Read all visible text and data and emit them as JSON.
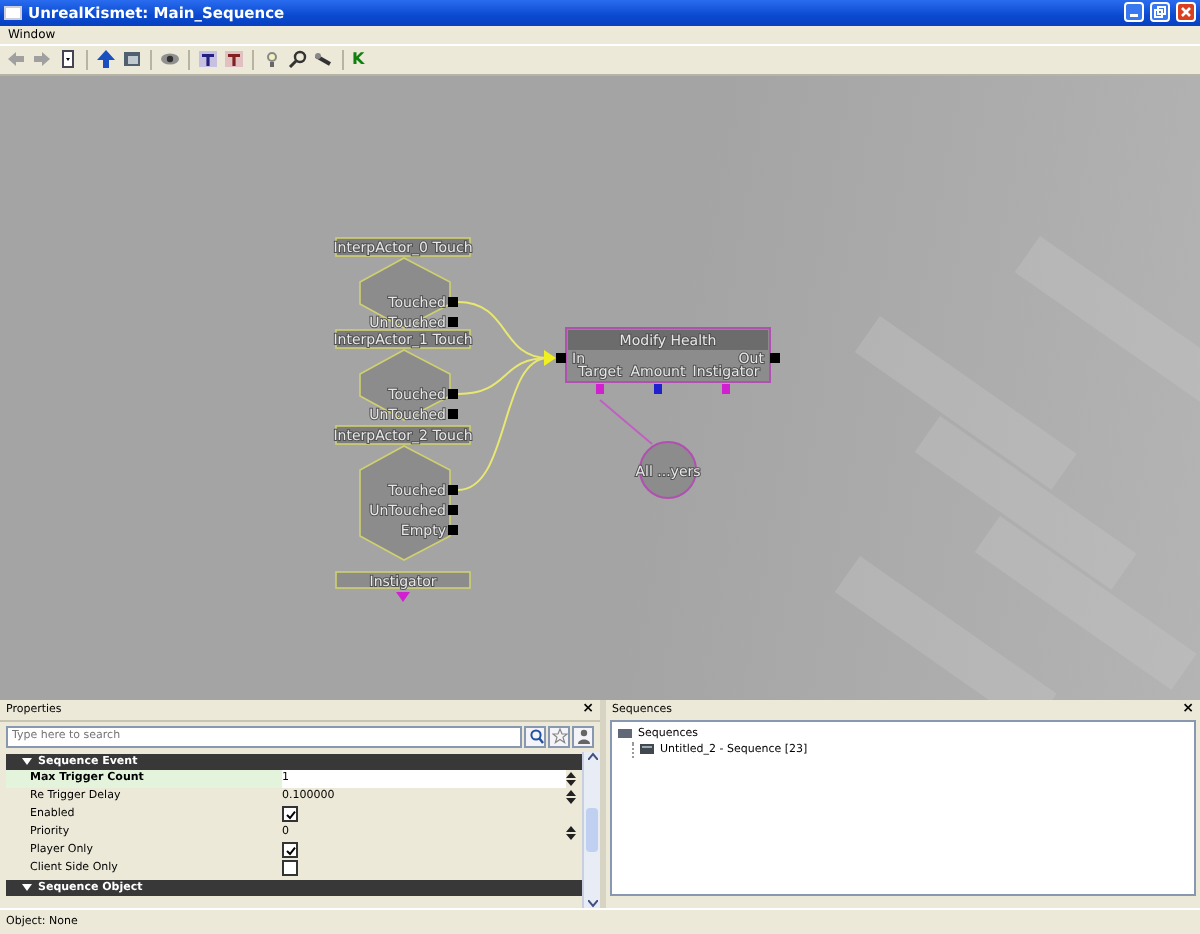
{
  "window": {
    "title": "UnrealKismet: Main_Sequence"
  },
  "menu": [
    "Window"
  ],
  "toolbar": {
    "k_button": "K"
  },
  "graph": {
    "events": [
      {
        "title": "InterpActor_0 Touch",
        "outputs": [
          "Touched",
          "UnTouched"
        ]
      },
      {
        "title": "InterpActor_1 Touch",
        "outputs": [
          "Touched",
          "UnTouched"
        ]
      },
      {
        "title": "InterpActor_2 Touch",
        "outputs": [
          "Touched",
          "UnTouched",
          "Empty"
        ]
      }
    ],
    "instigator": "Instigator",
    "action": {
      "title": "Modify Health",
      "input": "In",
      "output": "Out",
      "variables": [
        {
          "label": "Target",
          "color": "#d020d0"
        },
        {
          "label": "Amount",
          "color": "#2020d0"
        },
        {
          "label": "Instigator",
          "color": "#d020d0"
        }
      ]
    },
    "variable": {
      "label": "All ...yers"
    }
  },
  "properties": {
    "title": "Properties",
    "search_placeholder": "Type here to search",
    "categories": [
      {
        "title": "Sequence Event",
        "expanded": true,
        "rows": [
          {
            "name": "Max Trigger Count",
            "kind": "spin",
            "value": "1",
            "selected": true
          },
          {
            "name": "Re Trigger Delay",
            "kind": "spin",
            "value": "0.100000",
            "selected": false
          },
          {
            "name": "Enabled",
            "kind": "check",
            "checked": true,
            "selected": false
          },
          {
            "name": "Priority",
            "kind": "spin",
            "value": "0",
            "selected": false
          },
          {
            "name": "Player Only",
            "kind": "check",
            "checked": true,
            "selected": false
          },
          {
            "name": "Client Side Only",
            "kind": "check",
            "checked": false,
            "selected": false
          }
        ]
      },
      {
        "title": "Sequence Object",
        "expanded": true
      }
    ],
    "close": "×"
  },
  "sequences": {
    "title": "Sequences",
    "close": "×",
    "tree": [
      {
        "label": "Sequences",
        "children": [
          {
            "label": "Untitled_2 - Sequence [23]"
          }
        ]
      }
    ]
  },
  "status_bar": {
    "text": "Object: None"
  }
}
